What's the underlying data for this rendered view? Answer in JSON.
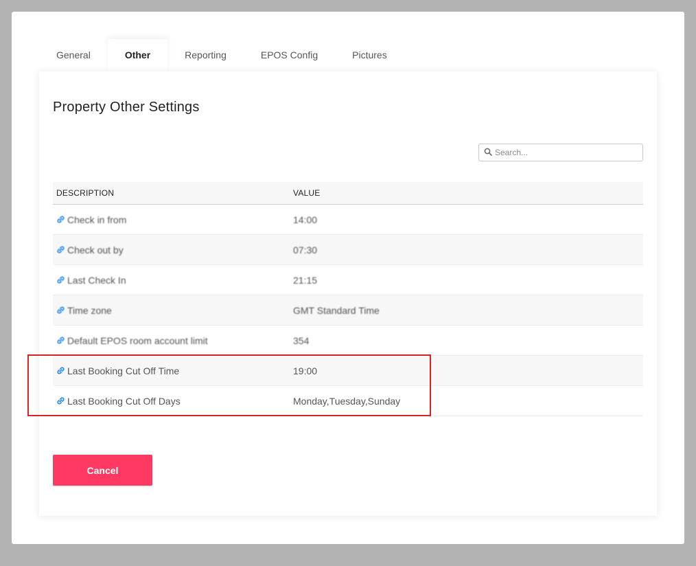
{
  "tabs": [
    {
      "label": "General",
      "active": false
    },
    {
      "label": "Other",
      "active": true
    },
    {
      "label": "Reporting",
      "active": false
    },
    {
      "label": "EPOS Config",
      "active": false
    },
    {
      "label": "Pictures",
      "active": false
    }
  ],
  "panel": {
    "title": "Property Other Settings"
  },
  "search": {
    "placeholder": "Search...",
    "value": ""
  },
  "table": {
    "headers": {
      "description": "DESCRIPTION",
      "value": "VALUE"
    },
    "rows": [
      {
        "description": "Check in from",
        "value": "14:00"
      },
      {
        "description": "Check out by",
        "value": "07:30"
      },
      {
        "description": "Last Check In",
        "value": "21:15"
      },
      {
        "description": "Time zone",
        "value": "GMT Standard Time"
      },
      {
        "description": "Default EPOS room account limit",
        "value": "354"
      },
      {
        "description": "Last Booking Cut Off Time",
        "value": "19:00"
      },
      {
        "description": "Last Booking Cut Off Days",
        "value": "Monday,Tuesday,Sunday"
      }
    ]
  },
  "buttons": {
    "cancel": "Cancel"
  },
  "colors": {
    "accent": "#ff3961",
    "link_icon": "#1e88e5",
    "highlight": "#d92125",
    "overlay": "#b3b3b3"
  },
  "icons": {
    "row_icon": "link-icon",
    "search": "search-icon"
  }
}
